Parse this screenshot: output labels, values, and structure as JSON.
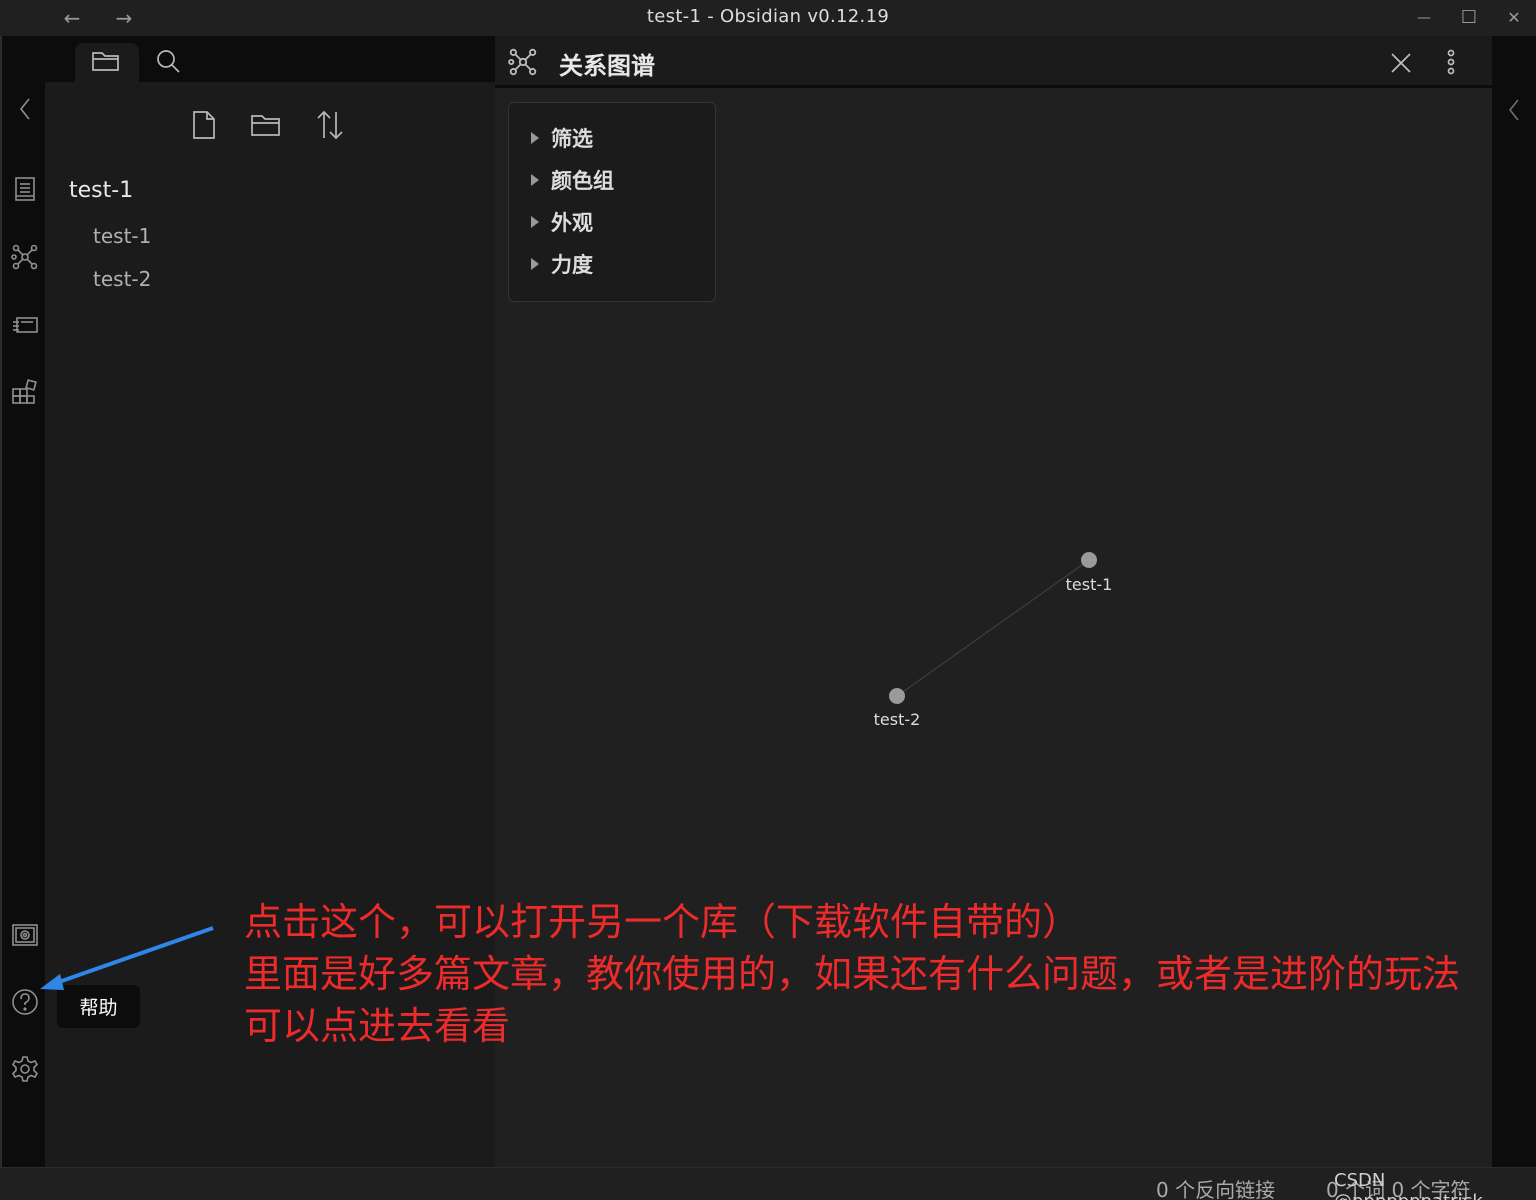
{
  "window": {
    "title": "test-1 - Obsidian v0.12.19",
    "nav_back_icon": "arrow-left-icon",
    "nav_forward_icon": "arrow-right-icon",
    "minimize": "—",
    "maximize": "☐",
    "close": "✕"
  },
  "ribbon": {
    "items": [
      "collapse-left-icon",
      "file-switcher-icon",
      "graph-view-icon",
      "slides-icon",
      "plugins-icon",
      "open-vault-icon",
      "help-icon",
      "settings-icon"
    ]
  },
  "file_explorer": {
    "tabs": [
      "folder-icon",
      "search-icon"
    ],
    "actions": [
      "new-note-icon",
      "new-folder-icon",
      "sort-icon"
    ],
    "vault_name": "test-1",
    "files": [
      "test-1",
      "test-2"
    ]
  },
  "graph_view": {
    "title": "关系图谱",
    "controls": [
      "筛选",
      "颜色组",
      "外观",
      "力度"
    ],
    "nodes": [
      {
        "label": "test-1"
      },
      {
        "label": "test-2"
      }
    ],
    "edges": [
      [
        "test-1",
        "test-2"
      ]
    ]
  },
  "tooltip": {
    "text": "帮助"
  },
  "annotation": {
    "line1": "点击这个，可以打开另一个库（下载软件自带的）",
    "line2": "里面是好多篇文章，教你使用的，如果还有什么问题，或者是进阶的玩法",
    "line3": "可以点进去看看",
    "color": "#ee2b2b",
    "arrow_color": "#2f86e8"
  },
  "status_bar": {
    "backlinks": "0 个反向链接",
    "counts": "0 个词  0 个字符"
  },
  "watermark": "CSDN @pppppppatrick",
  "colors": {
    "background": "#202020",
    "sidebar": "#1b1b1b",
    "ribbon": "#0c0c0c",
    "node": "#9a9a9a"
  }
}
